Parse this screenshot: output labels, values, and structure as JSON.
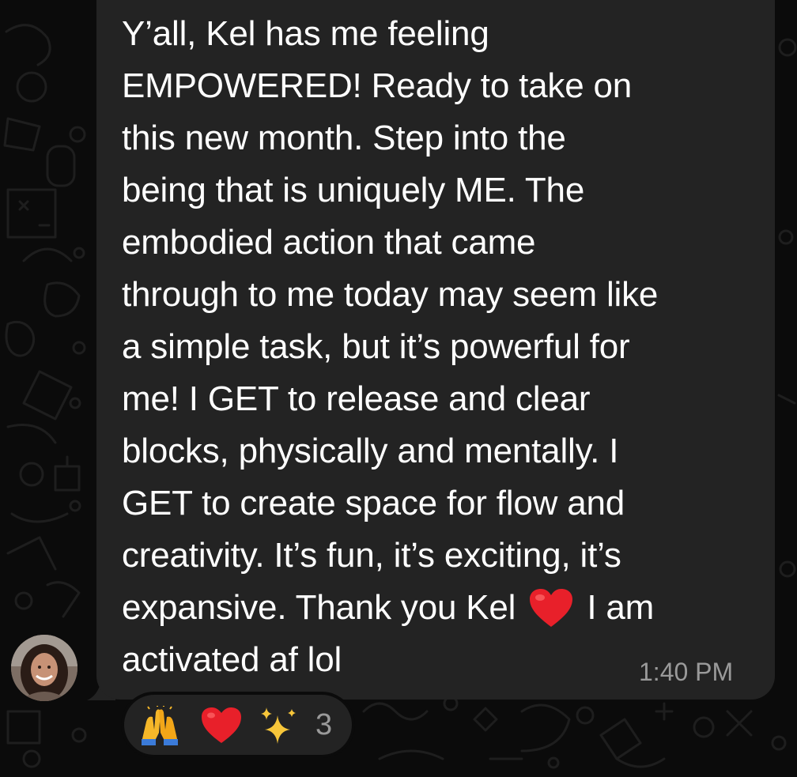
{
  "wallpaper": {
    "icon": "doodle-pattern-icon",
    "color": "#1e1e1e"
  },
  "message": {
    "text_before_heart": "Y’all, Kel has me feeling\nEMPOWERED! Ready to take on\nthis new month. Step into the\nbeing that is uniquely ME. The\nembodied action that came\nthrough to me today may seem like\na simple task, but it’s powerful for\nme! I GET to release and clear\nblocks, physically and mentally. I\nGET to create space for flow and\ncreativity. It’s fun, it’s exciting, it’s\nexpansive. Thank you Kel",
    "inline_emoji": {
      "name": "red-heart-icon",
      "glyph": "❤️",
      "color": "#e8202a"
    },
    "text_after_heart": "I am\nactivated af lol",
    "timestamp": "1:40 PM",
    "bubble_color": "#232323",
    "text_color": "#ffffff"
  },
  "sender": {
    "avatar": "avatar"
  },
  "reactions": {
    "items": [
      {
        "name": "raising-hands-icon",
        "glyph": "🙌"
      },
      {
        "name": "red-heart-icon",
        "glyph": "❤️"
      },
      {
        "name": "sparkles-icon",
        "glyph": "✨"
      }
    ],
    "count": "3"
  }
}
